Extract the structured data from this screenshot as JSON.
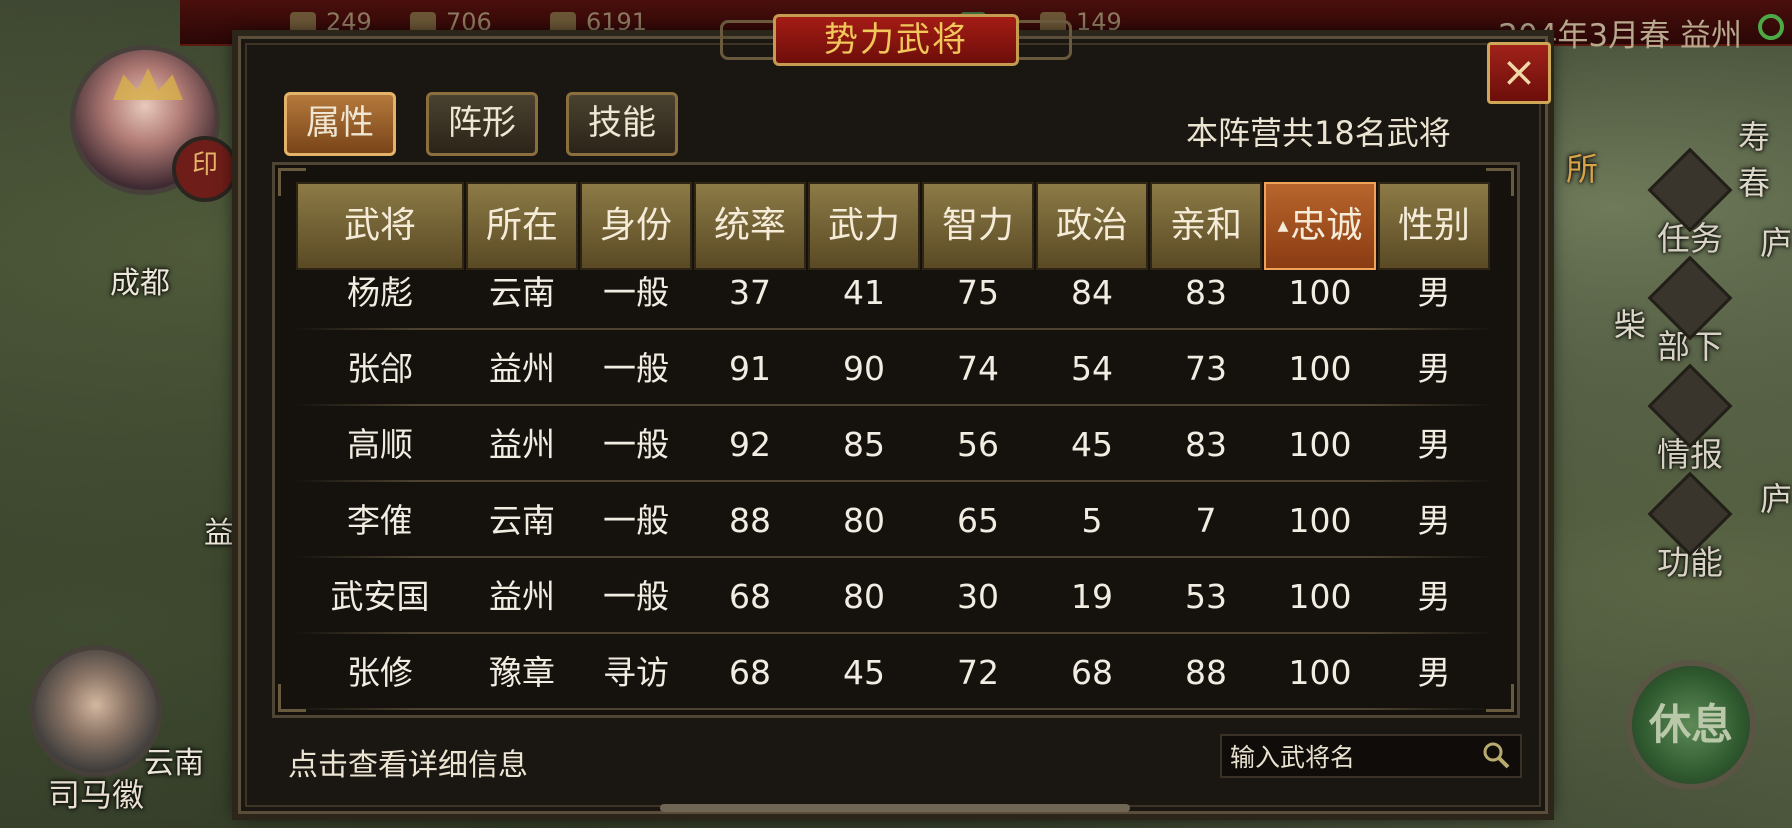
{
  "top_bar": {
    "resources": [
      "249",
      "706",
      "6191",
      "",
      "149"
    ],
    "date_location": "204年3月春 益州"
  },
  "map": {
    "cities": [
      "成都",
      "益",
      "云南",
      "寿春",
      "柴",
      "所",
      "庐",
      "庐"
    ],
    "advisor_name": "司马徽",
    "side_menu": [
      {
        "label": "任务",
        "icon": "task-scroll-icon"
      },
      {
        "label": "部下",
        "icon": "subordinate-icon"
      },
      {
        "label": "情报",
        "icon": "intel-icon"
      },
      {
        "label": "功能",
        "icon": "function-gear-icon"
      }
    ],
    "rest_button": "休息"
  },
  "dialog": {
    "title": "势力武将",
    "close_label": "×",
    "tabs": [
      {
        "label": "属性",
        "active": true
      },
      {
        "label": "阵形",
        "active": false
      },
      {
        "label": "技能",
        "active": false
      }
    ],
    "general_count_text": "本阵营共18名武将",
    "columns": [
      "武将",
      "所在",
      "身份",
      "统率",
      "武力",
      "智力",
      "政治",
      "亲和",
      "忠诚",
      "性别"
    ],
    "sorted_column": "忠诚",
    "rows": [
      [
        "杨彪",
        "云南",
        "一般",
        "37",
        "41",
        "75",
        "84",
        "83",
        "100",
        "男"
      ],
      [
        "张郃",
        "益州",
        "一般",
        "91",
        "90",
        "74",
        "54",
        "73",
        "100",
        "男"
      ],
      [
        "高顺",
        "益州",
        "一般",
        "92",
        "85",
        "56",
        "45",
        "83",
        "100",
        "男"
      ],
      [
        "李傕",
        "云南",
        "一般",
        "88",
        "80",
        "65",
        "5",
        "7",
        "100",
        "男"
      ],
      [
        "武安国",
        "益州",
        "一般",
        "68",
        "80",
        "30",
        "19",
        "53",
        "100",
        "男"
      ],
      [
        "张修",
        "豫章",
        "寻访",
        "68",
        "45",
        "72",
        "68",
        "88",
        "100",
        "男"
      ]
    ],
    "hint": "点击查看详细信息",
    "search": {
      "placeholder": "输入武将名"
    }
  },
  "colors": {
    "tab_active": "#b4793c",
    "title_red": "#a51c15",
    "header_gold": "#8c7a46",
    "sorted_header": "#b8652c",
    "text": "#f2ede2"
  }
}
